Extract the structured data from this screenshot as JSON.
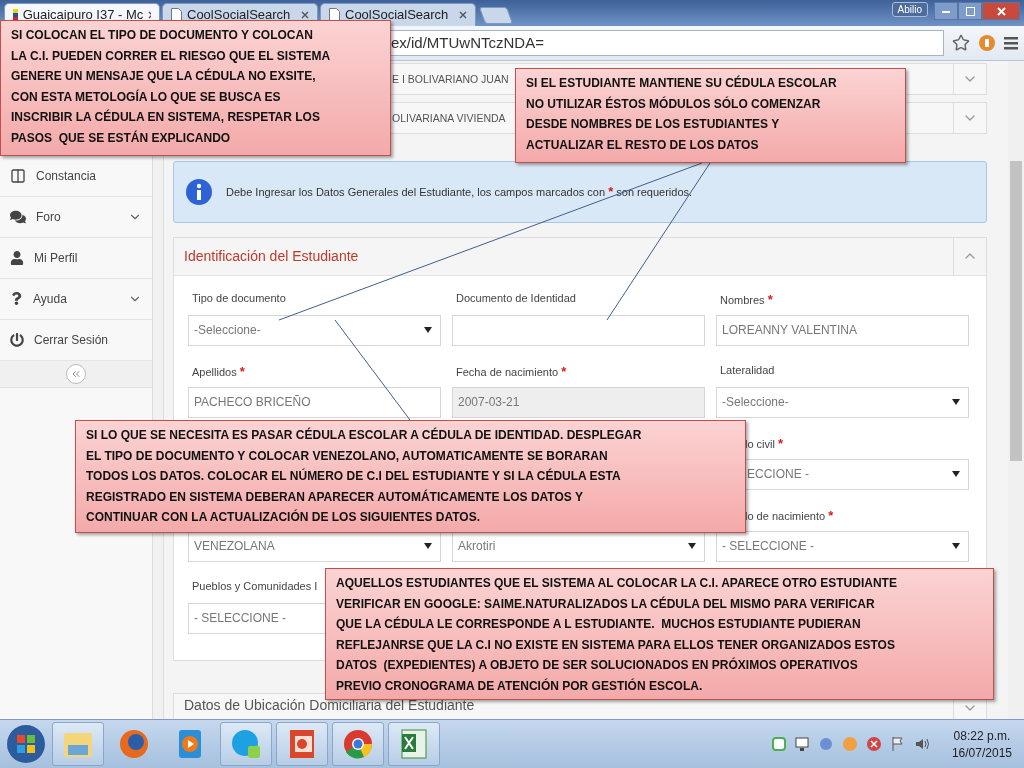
{
  "browser": {
    "tabs": [
      {
        "title": "Guaicaipuro I37 - Mc",
        "selected": true,
        "kind": "flag"
      },
      {
        "title": "CoolSocialSearch",
        "selected": false,
        "kind": "page"
      },
      {
        "title": "CoolSocialSearch",
        "selected": false,
        "kind": "page"
      }
    ],
    "user": "Abilio",
    "address": "ex/id/MTUwNTczNDA="
  },
  "sidebar": {
    "items": [
      {
        "label": "Constancia",
        "kind": "columns",
        "expandable": false
      },
      {
        "label": "Foro",
        "kind": "chat",
        "expandable": true
      },
      {
        "label": "Mi Perfil",
        "kind": "user",
        "expandable": false
      },
      {
        "label": "Ayuda",
        "kind": "help",
        "expandable": true
      },
      {
        "label": "Cerrar Sesión",
        "kind": "power",
        "expandable": false
      }
    ]
  },
  "accordions": [
    {
      "title": "E I BOLIVARIANO JUAN",
      "expanded": false
    },
    {
      "title": "OLIVARIANA VIVIENDA",
      "expanded": false
    }
  ],
  "alert": {
    "text_before": "Debe Ingresar los Datos Generales del Estudiante, los campos marcados con",
    "mark": "*",
    "text_after": "son requeridos."
  },
  "panel": {
    "title": "Identificación del Estudiante",
    "expanded": true,
    "rows": [
      [
        {
          "label": "Tipo de documento",
          "required": false,
          "kind": "select",
          "value": "-Seleccione-",
          "disabled": false
        },
        {
          "label": "Documento de Identidad",
          "required": false,
          "kind": "input",
          "disabled": false
        },
        {
          "label": "Nombres",
          "required": true,
          "kind": "input",
          "value": "LOREANNY VALENTINA",
          "disabled": false
        }
      ],
      [
        {
          "label": "Apellidos",
          "required": true,
          "kind": "input",
          "value": "PACHECO BRICEÑO",
          "disabled": false
        },
        {
          "label": "Fecha de nacimiento",
          "required": true,
          "kind": "input",
          "value": "2007-03-21",
          "disabled": true
        },
        {
          "label": "Lateralidad",
          "required": false,
          "kind": "select",
          "value": "-Seleccione-",
          "disabled": false
        }
      ],
      [
        {
          "kind": "covered"
        },
        {
          "kind": "covered"
        },
        {
          "label": "lo civil",
          "required": true,
          "kind": "select",
          "value": "ECCIONE -",
          "disabled": false
        }
      ],
      [
        {
          "kind": "select",
          "value": "VENEZOLANA",
          "disabled": false
        },
        {
          "kind": "select",
          "value": "Akrotiri",
          "disabled": false
        },
        {
          "label": "lo de nacimiento",
          "required": true,
          "kind": "select",
          "value": "- SELECCIONE -",
          "disabled": false
        }
      ],
      [
        {
          "label": "Pueblos y Comunidades I",
          "required": false,
          "kind": "select",
          "value": "- SELECCIONE -",
          "disabled": false
        },
        {
          "kind": "covered"
        },
        {
          "kind": "covered"
        }
      ]
    ]
  },
  "next_panel": {
    "title": "Datos de Ubicación Domiciliaria del Estudiante",
    "expanded": false
  },
  "notes": [
    {
      "text": "SI COLOCAN EL TIPO DE DOCUMENTO Y COLOCAN\nLA C.I. PUEDEN CORRER EL RIESGO QUE EL SISTEMA\nGENERE UN MENSAJE QUE LA CÉDULA NO EXSITE,\nCON ESTA METOLOGÍA LO QUE SE BUSCA ES\nINSCRIBIR LA CÉDULA EN SISTEMA, RESPETAR LOS\nPASOS  QUE SE ESTÁN EXPLICANDO"
    },
    {
      "text": "SI EL ESTUDIANTE MANTIENE SU CÉDULA ESCOLAR\nNO UTILIZAR ÉSTOS MÓDULOS SÓLO COMENZAR\nDESDE NOMBRES DE LOS ESTUDIANTES Y\nACTUALIZAR EL RESTO DE LOS DATOS"
    },
    {
      "text": "SI LO QUE SE NECESITA ES PASAR CÉDULA ESCOLAR A CÉDULA DE IDENTIDAD. DESPLEGAR\nEL TIPO DE DOCUMENTO Y COLOCAR VENEZOLANO, AUTOMATICAMENTE SE BORARAN\nTODOS LOS DATOS. COLOCAR EL NÚMERO DE C.I DEL ESTUDIANTE Y SI LA CÉDULA ESTA\nREGISTRADO EN SISTEMA DEBERAN APARECER AUTOMÁTICAMENTE LOS DATOS Y\nCONTINUAR CON LA ACTUALIZACIÓN DE LOS SIGUIENTES DATOS."
    },
    {
      "text": "AQUELLOS ESTUDIANTES QUE EL SISTEMA AL COLOCAR LA C.I. APARECE OTRO ESTUDIANTE\nVERIFICAR EN GOOGLE: SAIME.NATURALIZADOS LA CÉDULA DEL MISMO PARA VERIFICAR\nQUE LA CÉDULA LE CORRESPONDE A L ESTUDIANTE.  MUCHOS ESTUDIANTE PUDIERAN\nREFLEJANRSE QUE LA C.I NO EXISTE EN SISTEMA PARA ELLOS TENER ORGANIZADOS ESTOS\nDATOS  (EXPEDIENTES) A OBJETO DE SER SOLUCIONADOS EN PRÓXIMOS OPERATIVOS\nPREVIO CRONOGRAMA DE ATENCIÓN POR GESTIÓN ESCOLA."
    }
  ],
  "taskbar": {
    "apps": [
      {
        "kind": "folder",
        "running": true
      },
      {
        "kind": "firefox",
        "running": false
      },
      {
        "kind": "player",
        "running": false
      },
      {
        "kind": "skype",
        "running": true
      },
      {
        "kind": "powerpoint",
        "running": true
      },
      {
        "kind": "chrome",
        "running": true
      },
      {
        "kind": "excel",
        "running": true
      }
    ],
    "time": "08:22 p.m.",
    "date": "16/07/2015"
  }
}
